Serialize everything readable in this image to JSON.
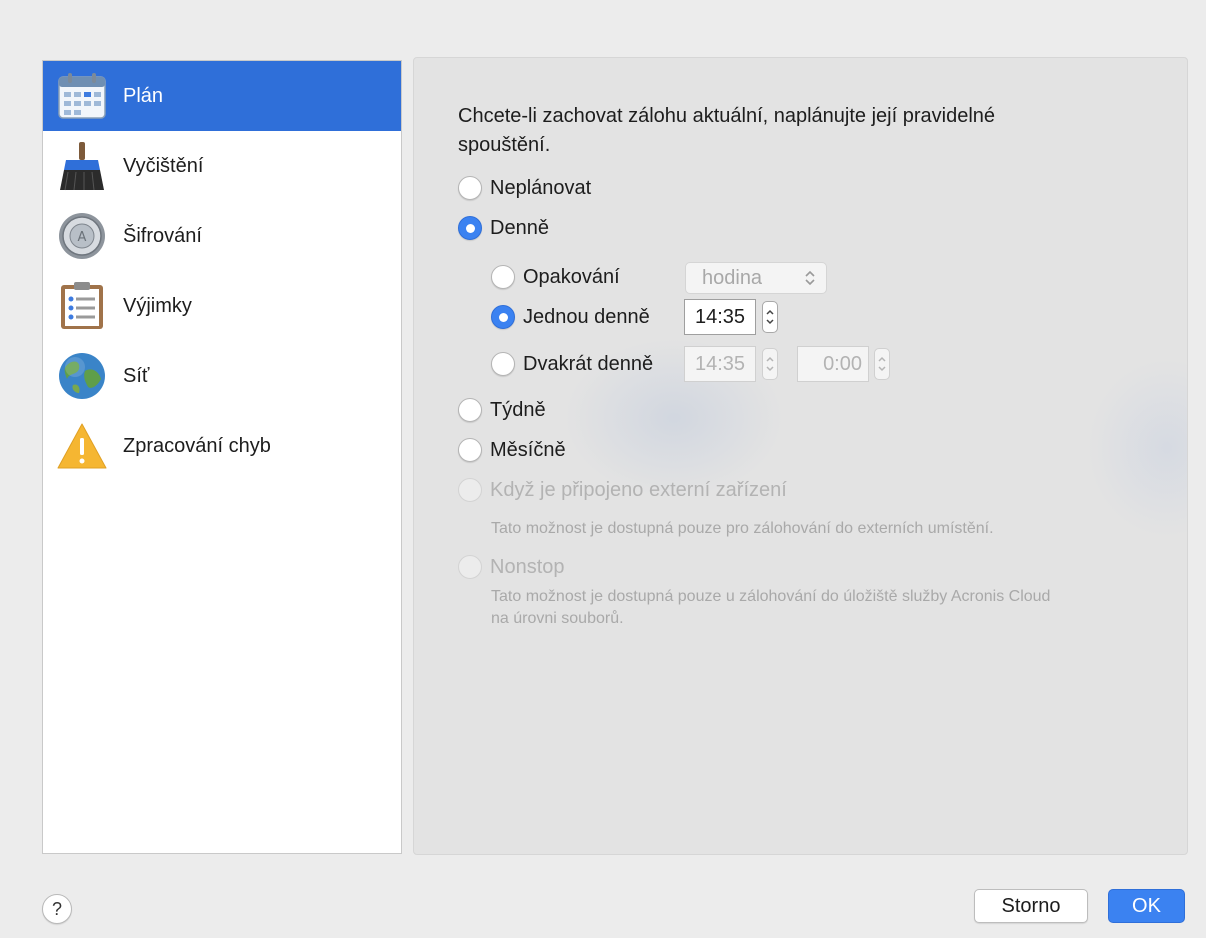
{
  "sidebar": {
    "items": [
      {
        "label": "Plán",
        "icon": "calendar-icon",
        "selected": true
      },
      {
        "label": "Vyčištění",
        "icon": "broom-icon"
      },
      {
        "label": "Šifrování",
        "icon": "safe-dial-icon"
      },
      {
        "label": "Výjimky",
        "icon": "clipboard-list-icon"
      },
      {
        "label": "Síť",
        "icon": "globe-icon"
      },
      {
        "label": "Zpracování chyb",
        "icon": "warning-icon"
      }
    ]
  },
  "main": {
    "intro": "Chcete-li zachovat zálohu aktuální, naplánujte její pravidelné spouštění.",
    "options": {
      "none": "Neplánovat",
      "daily": "Denně",
      "repeat": "Opakování",
      "repeat_unit": "hodina",
      "once": "Jednou denně",
      "once_time": "14:35",
      "twice": "Dvakrát denně",
      "twice_time1": "14:35",
      "twice_time2": "0:00",
      "weekly": "Týdně",
      "monthly": "Měsíčně",
      "external": "Když je připojeno externí zařízení",
      "external_note": "Tato možnost je dostupná pouze pro zálohování do externích umístění.",
      "nonstop": "Nonstop",
      "nonstop_note": "Tato možnost je dostupná pouze u zálohování do úložiště služby Acronis Cloud na úrovni souborů."
    }
  },
  "footer": {
    "help": "?",
    "cancel": "Storno",
    "ok": "OK"
  },
  "colors": {
    "accent": "#3b82f1",
    "selection": "#2f6fd9",
    "disabled_text": "#b3b3b3"
  }
}
